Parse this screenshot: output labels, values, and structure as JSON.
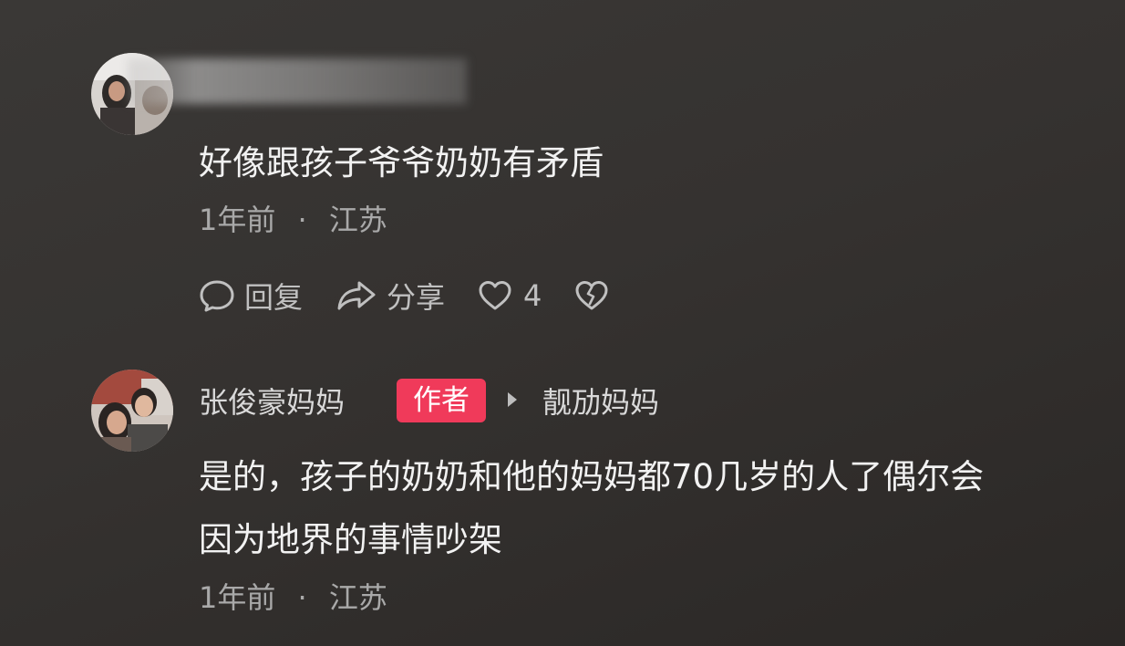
{
  "comments": [
    {
      "text": "好像跟孩子爷爷奶奶有矛盾",
      "time": "1年前",
      "separator": "·",
      "location": "江苏",
      "actions": {
        "reply_label": "回复",
        "share_label": "分享",
        "like_count": "4"
      }
    },
    {
      "author": "张俊豪妈妈",
      "author_badge": "作者",
      "reply_to": "靓劢妈妈",
      "text_line1": "是的，孩子的奶奶和他的妈妈都70几岁的人了偶尔会",
      "text_line2": "因为地界的事情吵架",
      "time": "1年前",
      "separator": "·",
      "location": "江苏"
    }
  ],
  "colors": {
    "background": "#363331",
    "text_primary": "#f2f2f2",
    "text_secondary": "#a9a9a9",
    "author_badge": "#f03a5a"
  },
  "icons": [
    "comment-bubble-icon",
    "share-arrow-icon",
    "heart-icon",
    "broken-heart-icon",
    "caret-right-icon"
  ]
}
